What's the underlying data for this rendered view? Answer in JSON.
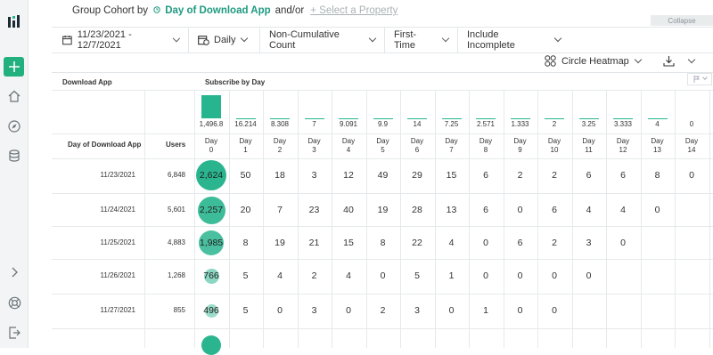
{
  "sidebar": {
    "logo_icon": "logo-icon",
    "add_icon": "plus-icon",
    "items": [
      "home-icon",
      "compass-icon",
      "database-icon"
    ],
    "expand_icon": "chevron-right-icon",
    "help_icon": "lifebuoy-icon",
    "exit_icon": "logout-icon"
  },
  "group": {
    "label": "Group Cohort by",
    "property": "Day of Download App",
    "andor": "and/or",
    "select_placeholder": "+ Select a Property",
    "collapse": "Collapse"
  },
  "toolbar": {
    "date_range": "11/23/2021 - 12/7/2021",
    "interval": "Daily",
    "count_mode": "Non-Cumulative Count",
    "first_time": "First-Time",
    "incomplete": "Include Incomplete"
  },
  "view": {
    "mode": "Circle Heatmap"
  },
  "table": {
    "left_header": "Download App",
    "right_header": "Subscribe by Day",
    "row_header": "Day of Download App",
    "users_header": "Users",
    "day_label": "Day",
    "days": [
      "0",
      "1",
      "2",
      "3",
      "4",
      "5",
      "6",
      "7",
      "8",
      "9",
      "10",
      "11",
      "12",
      "13",
      "14"
    ],
    "bar_labels": [
      "1,496.8",
      "16.214",
      "8.308",
      "7",
      "9.091",
      "9.9",
      "14",
      "7.25",
      "2.571",
      "1.333",
      "2",
      "3.25",
      "3.333",
      "4",
      "0"
    ],
    "bar_values": [
      1496.8,
      16.214,
      8.308,
      7,
      9.091,
      9.9,
      14,
      7.25,
      2.571,
      1.333,
      2,
      3.25,
      3.333,
      4,
      0
    ],
    "rows": [
      {
        "date": "11/23/2021",
        "users": "6,848",
        "cells": [
          "2,624",
          "50",
          "18",
          "3",
          "12",
          "49",
          "29",
          "15",
          "6",
          "2",
          "2",
          "6",
          "6",
          "8",
          "0"
        ]
      },
      {
        "date": "11/24/2021",
        "users": "5,601",
        "cells": [
          "2,257",
          "20",
          "7",
          "23",
          "40",
          "19",
          "28",
          "13",
          "6",
          "0",
          "6",
          "4",
          "4",
          "0",
          ""
        ]
      },
      {
        "date": "11/25/2021",
        "users": "4,883",
        "cells": [
          "1,985",
          "8",
          "19",
          "21",
          "15",
          "8",
          "22",
          "4",
          "0",
          "6",
          "2",
          "3",
          "0",
          "",
          ""
        ]
      },
      {
        "date": "11/26/2021",
        "users": "1,268",
        "cells": [
          "766",
          "5",
          "4",
          "2",
          "4",
          "0",
          "5",
          "1",
          "0",
          "0",
          "0",
          "0",
          "",
          "",
          ""
        ]
      },
      {
        "date": "11/27/2021",
        "users": "855",
        "cells": [
          "496",
          "5",
          "0",
          "3",
          "0",
          "2",
          "3",
          "0",
          "1",
          "0",
          "0",
          "",
          "",
          "",
          ""
        ]
      }
    ],
    "circle_fractions": [
      1.0,
      0.86,
      0.77,
      0.29,
      0.19,
      1.0
    ]
  },
  "colors": {
    "accent": "#26b58e",
    "link": "#1f9a80"
  }
}
